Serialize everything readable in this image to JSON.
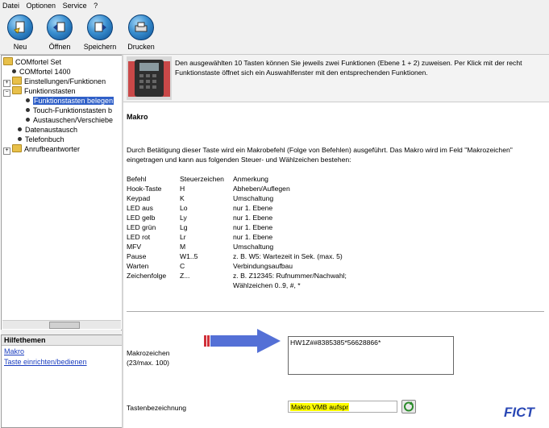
{
  "menu": [
    "Datei",
    "Optionen",
    "Service",
    "?"
  ],
  "toolbar": {
    "new_label": "Neu",
    "open_label": "Öffnen",
    "save_label": "Speichern",
    "print_label": "Drucken"
  },
  "tree": {
    "items": [
      {
        "label": "COMfortel Set"
      },
      {
        "label": "COMfortel 1400"
      },
      {
        "label": "Einstellungen/Funktionen"
      },
      {
        "label": "Funktionstasten"
      },
      {
        "label": "Funktionstasten belegen"
      },
      {
        "label": "Touch-Funktionstasten b"
      },
      {
        "label": "Austauschen/Verschiebe"
      },
      {
        "label": "Datenaustausch"
      },
      {
        "label": "Telefonbuch"
      },
      {
        "label": "Anrufbeantworter"
      }
    ],
    "expander_plus": "+",
    "expander_minus": "−"
  },
  "help": {
    "header": "Hilfethemen",
    "links": [
      "Makro",
      "Taste einrichten/bedienen"
    ]
  },
  "banner": {
    "line1": "Den ausgewählten 10 Tasten können Sie jeweils zwei Funktionen (Ebene 1 + 2) zuweisen. Per Klick mit der recht",
    "line2": "Funktionstaste öffnet sich ein Auswahlfenster mit den entsprechenden Funktionen."
  },
  "content": {
    "title": "Makro",
    "desc1": "Durch Betätigung dieser Taste wird ein Makrobefehl (Folge von Befehlen) ausgeführt. Das Makro wird im Feld \"Makrozeichen\"",
    "desc2": "eingetragen und kann aus folgenden Steuer- und Wählzeichen bestehen:",
    "table_headers": [
      "Befehl",
      "Steuerzeichen",
      "Anmerkung"
    ],
    "table_rows": [
      [
        "Hook-Taste",
        "H",
        "Abheben/Auflegen"
      ],
      [
        "Keypad",
        "K",
        "Umschaltung"
      ],
      [
        "LED aus",
        "Lo",
        "nur 1. Ebene"
      ],
      [
        "LED gelb",
        "Ly",
        "nur 1. Ebene"
      ],
      [
        "LED grün",
        "Lg",
        "nur 1. Ebene"
      ],
      [
        "LED rot",
        "Lr",
        "nur 1. Ebene"
      ],
      [
        "MFV",
        "M",
        "Umschaltung"
      ],
      [
        "Pause",
        "W1..5",
        "z. B. W5: Wartezeit in Sek. (max. 5)"
      ],
      [
        "Warten",
        "C",
        "Verbindungsaufbau"
      ],
      [
        "Zeichenfolge",
        "Z...",
        "z. B. Z12345: Rufnummer/Nachwahl;"
      ],
      [
        "",
        "",
        "Wählzeichen 0..9, #, *"
      ]
    ],
    "makro_label": "Makrozeichen",
    "makro_count": "(23/max. 100)",
    "makro_value": "HW1Z##8385385*56628866*",
    "tasten_label": "Tastenbezeichnung",
    "tasten_value": "Makro VMB aufspr"
  },
  "watermark": "FICT",
  "colors": {
    "selection": "#3060c8",
    "arrow": "#5470d6",
    "highlight": "#ffff00",
    "watermark": "#2a48b5",
    "link": "#1a3dbf"
  }
}
